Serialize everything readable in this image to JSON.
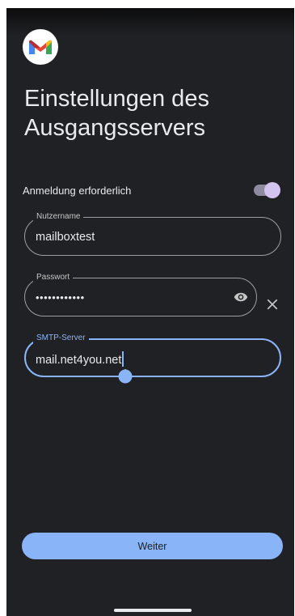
{
  "screen": {
    "title": "Einstellungen des Ausgangsservers"
  },
  "auth": {
    "label": "Anmeldung erforderlich",
    "enabled": true
  },
  "fields": {
    "username": {
      "label": "Nutzername",
      "value": "mailboxtest"
    },
    "password": {
      "label": "Passwort",
      "value": "••••••••••••"
    },
    "smtp": {
      "label": "SMTP-Server",
      "value": "mail.net4you.net"
    }
  },
  "actions": {
    "next_label": "Weiter"
  },
  "colors": {
    "background": "#202124",
    "accent": "#8ab4f8",
    "toggle_knob": "#d3c3ef"
  },
  "icons": {
    "logo": "gmail-logo",
    "password_visibility": "eye-icon",
    "clear": "close-icon"
  }
}
